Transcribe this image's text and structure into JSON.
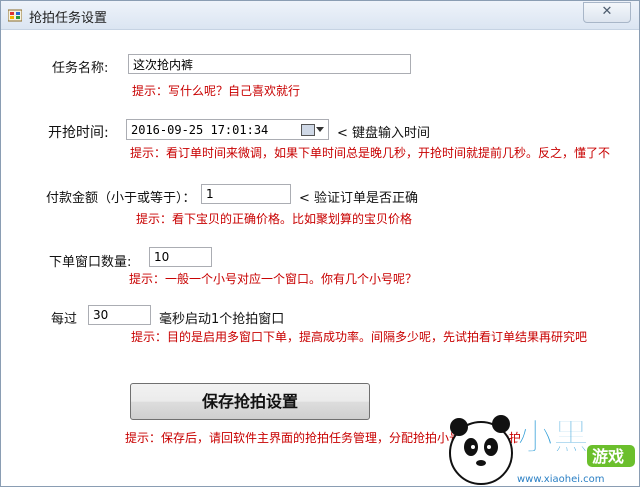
{
  "window": {
    "title": "抢拍任务设置",
    "close_symbol": "✕"
  },
  "task_name": {
    "label": "任务名称:",
    "value": "这次抢内裤",
    "hint": "提示：写什么呢？自己喜欢就行"
  },
  "start_time": {
    "label": "开抢时间:",
    "value": "2016-09-25 17:01:34",
    "side_note": "< 键盘输入时间",
    "hint": "提示：看订单时间来微调，如果下单时间总是晚几秒，开抢时间就提前几秒。反之，懂了不"
  },
  "payment": {
    "label": "付款金额（小于或等于）：",
    "value": "1",
    "side_note": "< 验证订单是否正确",
    "hint": "提示：看下宝贝的正确价格。比如聚划算的宝贝价格"
  },
  "window_count": {
    "label": "下单窗口数量:",
    "value": "10",
    "hint": "提示：一般一个小号对应一个窗口。你有几个小号呢？"
  },
  "interval": {
    "label_prefix": "每过",
    "value": "30",
    "label_suffix": "毫秒启动1个抢拍窗口",
    "hint": "提示：目的是启用多窗口下单，提高成功率。间隔多少呢，先试拍看订单结果再研究吧"
  },
  "save": {
    "label": "保存抢拍设置",
    "hint": "提示：保存后，请回软件主界面的抢拍任务管理，分配抢拍小号后开始抢拍"
  },
  "watermark": {
    "brand": "小黑",
    "sub": "游戏",
    "site": "www.xiaohei.com"
  },
  "colors": {
    "hint": "#c80000"
  }
}
